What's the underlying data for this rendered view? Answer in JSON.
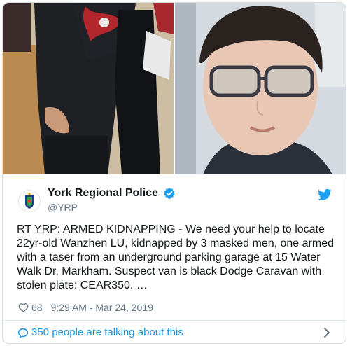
{
  "tweet": {
    "display_name": "York Regional Police",
    "handle": "@YRP",
    "text": "RT YRP: ARMED KIDNAPPING - We need your help to locate 22yr-old Wanzhen LU, kidnapped by 3 masked men, one armed with a taser from an underground parking garage at 15 Water Walk Dr, Markham. Suspect van is black Dodge Caravan with stolen plate: CEAR350. …",
    "likes": "68",
    "timestamp": "9:29 AM - Mar 24, 2019",
    "footer_text": "350 people are talking about this"
  },
  "icons": {
    "avatar": "police-crest-icon",
    "verified": "verified-badge-icon",
    "brand": "twitter-bird-icon",
    "like": "heart-icon",
    "talk": "speech-bubble-icon",
    "more": "chevron-right-icon"
  },
  "colors": {
    "brand_blue": "#1da1f2",
    "link_blue": "#1b95e0",
    "muted": "#657786",
    "text": "#14171a"
  }
}
